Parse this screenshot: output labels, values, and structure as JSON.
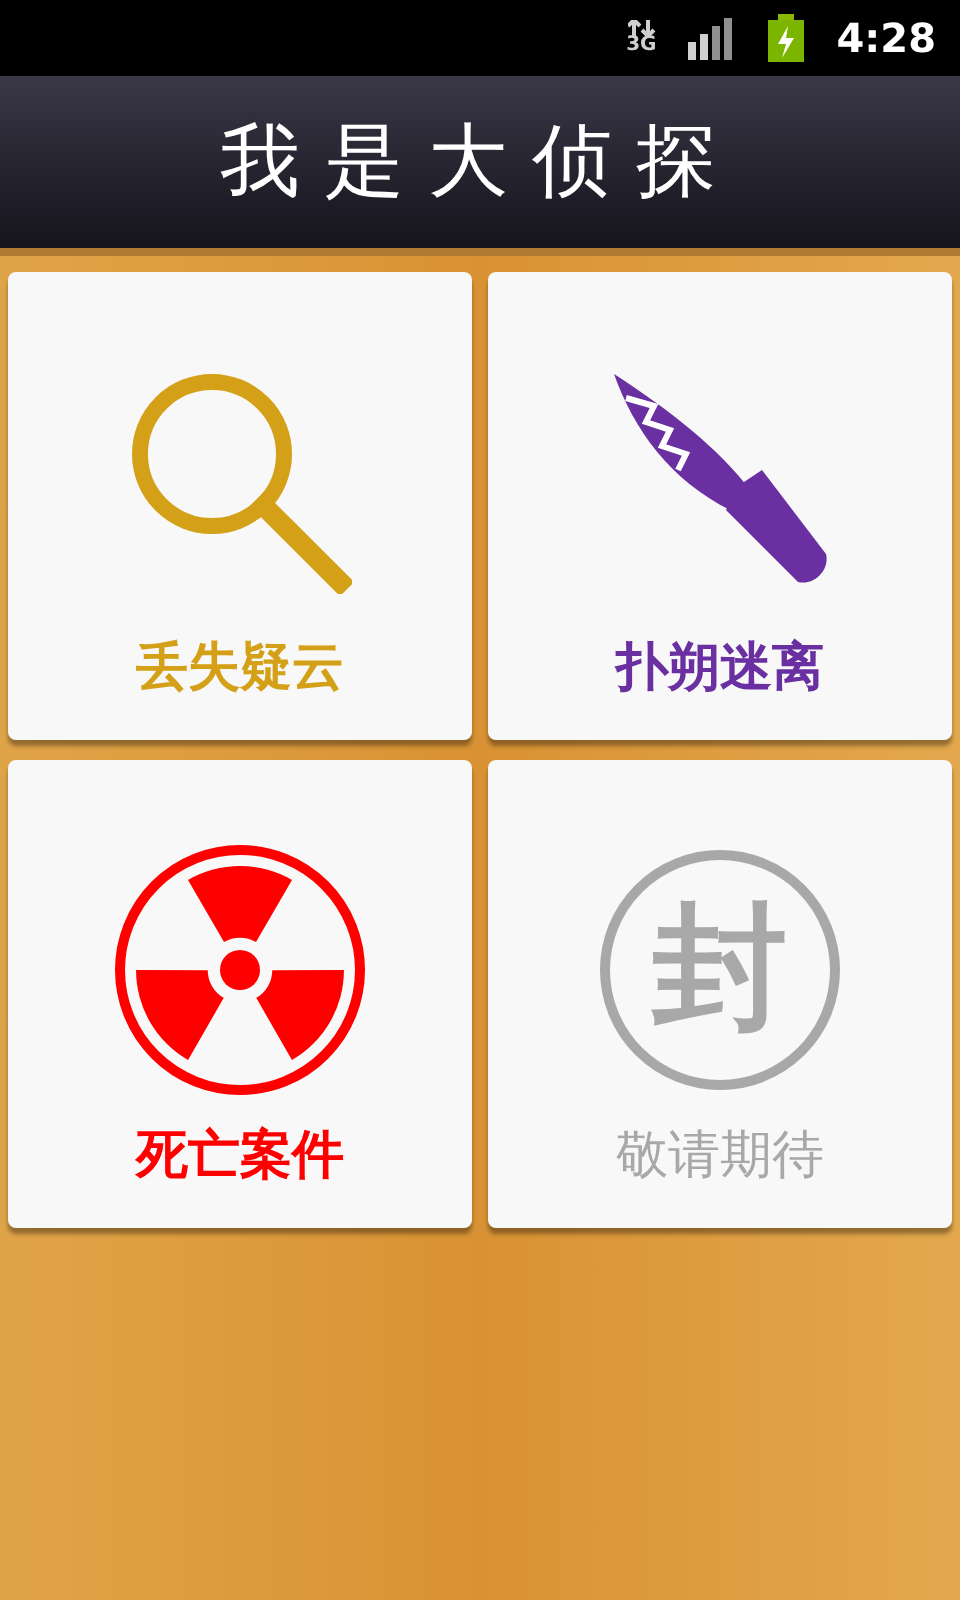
{
  "status_bar": {
    "network": "3G",
    "time": "4:28"
  },
  "header": {
    "title": "我是大侦探"
  },
  "cases": [
    {
      "kind": "magnifier",
      "label": "丢失疑云",
      "color": "#d4a017",
      "disabled": false
    },
    {
      "kind": "knife",
      "label": "扑朔迷离",
      "color": "#6a2fa0",
      "disabled": false
    },
    {
      "kind": "radiation",
      "label": "死亡案件",
      "color": "#ff0000",
      "disabled": false
    },
    {
      "kind": "seal",
      "label": "敬请期待",
      "color": "#a8a8a8",
      "disabled": true
    }
  ],
  "seal_icon": {
    "text": "封"
  }
}
